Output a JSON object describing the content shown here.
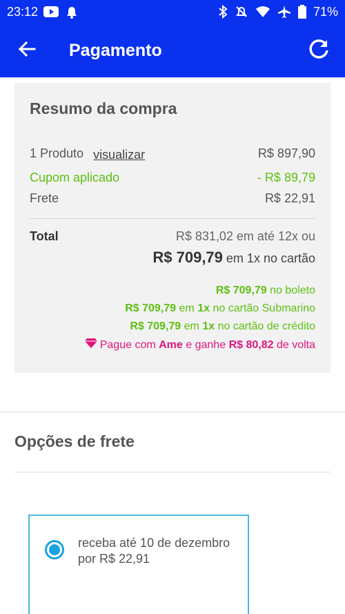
{
  "status_bar": {
    "time": "23:12",
    "battery": "71%",
    "icons": [
      "youtube-icon",
      "notification-icon",
      "bluetooth-icon",
      "mute-icon",
      "wifi-icon",
      "airplane-icon",
      "battery-icon"
    ]
  },
  "app_bar": {
    "title": "Pagamento",
    "back_icon": "arrow-left-icon",
    "refresh_icon": "refresh-icon"
  },
  "summary": {
    "title": "Resumo da compra",
    "product_label": "1 Produto",
    "view_link": "visualizar",
    "product_price": "R$ 897,90",
    "coupon_label": "Cupom aplicado",
    "coupon_value": "- R$ 89,79",
    "shipping_label": "Frete",
    "shipping_value": "R$ 22,91",
    "total_label": "Total",
    "total_installments": "R$ 831,02 em até 12x ou",
    "total_cash_price": "R$ 709,79",
    "total_cash_suffix": "em 1x no cartão",
    "offers": {
      "boleto_price": "R$ 709,79",
      "boleto_text": "no boleto",
      "submarino_price": "R$ 709,79",
      "submarino_mid": "em",
      "submarino_times": "1x",
      "submarino_text": "no cartão Submarino",
      "credit_price": "R$ 709,79",
      "credit_mid": "em",
      "credit_times": "1x",
      "credit_text": "no cartão de crédito",
      "ame_prefix": "Pague com",
      "ame_brand": "Ame",
      "ame_mid": "e ganhe",
      "ame_value": "R$ 80,82",
      "ame_suffix": "de volta"
    }
  },
  "shipping": {
    "title": "Opções de frete",
    "option_text": "receba até 10 de dezembro por R$ 22,91",
    "option_selected": true
  },
  "colors": {
    "primary": "#0a31ee",
    "green": "#5dbf12",
    "pink": "#e0157d",
    "radio": "#19a3e0"
  }
}
